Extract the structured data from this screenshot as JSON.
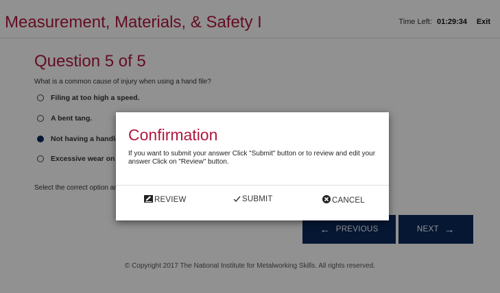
{
  "header": {
    "title": "Measurement, Materials, & Safety I",
    "time_label": "Time Left:",
    "time_value": "01:29:34",
    "exit_label": "Exit"
  },
  "question": {
    "title": "Question 5 of 5",
    "text": "What is a common cause of injury when using a hand file?",
    "options": [
      {
        "label": "Filing at too high a speed.",
        "selected": false
      },
      {
        "label": "A bent tang.",
        "selected": false
      },
      {
        "label": "Not having a handle on the file.",
        "selected": true
      },
      {
        "label": "Excessive wear on the file teeth.",
        "selected": false
      }
    ],
    "select_note": "Select the correct option and click Next."
  },
  "nav": {
    "previous_label": "PREVIOUS",
    "next_label": "NEXT"
  },
  "footer": {
    "copyright": "© Copyright 2017 The National Institute for Metalworking Skills. All rights reserved."
  },
  "modal": {
    "title": "Confirmation",
    "body": "If you want to submit your answer Click \"Submit\" button or to review and edit your answer Click on \"Review\" button.",
    "review_label": "REVIEW",
    "submit_label": "SUBMIT",
    "cancel_label": "CANCEL"
  },
  "icons": {
    "review": "edit-icon",
    "submit": "check-icon",
    "cancel": "cancel-circle-icon",
    "previous": "arrow-left-icon",
    "next": "arrow-right-icon"
  },
  "colors": {
    "accent": "#b0173f",
    "button_bg": "#0c2a5c",
    "radio_selected": "#0c2a5c"
  }
}
